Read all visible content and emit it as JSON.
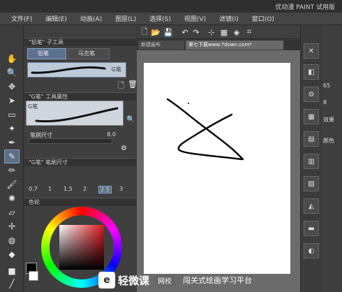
{
  "app": {
    "title": "优动漫 PAINT 试用版"
  },
  "menu": [
    "文件(F)",
    "编辑(E)",
    "动画(A)",
    "图层(L)",
    "选择(S)",
    "视图(V)",
    "滤镜(I)",
    "窗口(O)"
  ],
  "subtool_panel": {
    "title": "\"铅笔\" 子工具",
    "tabs": [
      "铅笔",
      "马克笔"
    ],
    "selected_brush": "G笔"
  },
  "tool_property": {
    "title": "\"G笔\" 工具属性",
    "preview_label": "G笔",
    "size_label": "笔刷尺寸",
    "size_value": "8.0"
  },
  "brush_size_panel": {
    "title": "\"G笔\" 笔刷尺寸",
    "sizes": [
      "0.7",
      "1",
      "1.5",
      "2",
      "2.5",
      "3"
    ],
    "selected_size": "2.5"
  },
  "color_panel": {
    "label": "色轮",
    "main_color": "#000000",
    "sub_color": "#ffffff"
  },
  "doc_tabs": [
    {
      "label": "新建画布",
      "active": false
    },
    {
      "label": "第七下载www.7down.com*",
      "active": true
    }
  ],
  "right_panel": {
    "values": [
      "65",
      "8"
    ],
    "labels": [
      "效果",
      "颜色"
    ]
  },
  "watermark": {
    "logo": "e",
    "brand": "轻微课",
    "tag": "网校",
    "slogan": "闯关式绘画学习平台"
  }
}
